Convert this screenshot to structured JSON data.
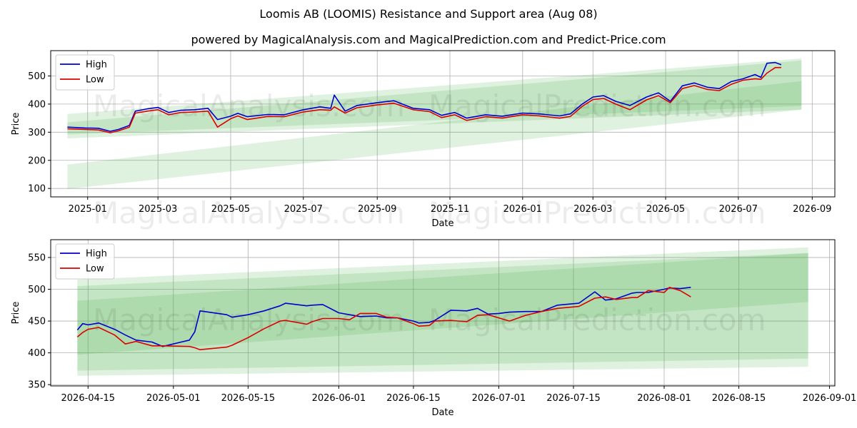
{
  "title": "Loomis AB (LOOMIS) Resistance and Support area (Aug 08)",
  "subtitle": "powered by MagicalAnalysis.com and MagicalPrediction.com and Predict-Price.com",
  "watermarks": [
    "MagicalAnalysis.com",
    "MagicalPrediction.com"
  ],
  "colors": {
    "high": "#0000cc",
    "low": "#dd0000",
    "band": "#4caf50"
  },
  "chart_data": [
    {
      "type": "line",
      "xlabel": "Date",
      "ylabel": "Price",
      "xlim": [
        "2024-12-01",
        "2026-09-20"
      ],
      "ylim": [
        70,
        590
      ],
      "x_ticks": [
        "2025-01",
        "2025-03",
        "2025-05",
        "2025-07",
        "2025-09",
        "2025-11",
        "2026-01",
        "2026-03",
        "2026-05",
        "2026-07",
        "2026-09"
      ],
      "y_ticks": [
        100,
        200,
        300,
        400,
        500
      ],
      "grid": true,
      "legend": "top-left",
      "bands": [
        {
          "x": [
            "2024-12-15",
            "2026-08-23"
          ],
          "upper": [
            365,
            562
          ],
          "lower": [
            278,
            380
          ]
        },
        {
          "x": [
            "2024-12-15",
            "2026-08-23"
          ],
          "upper": [
            335,
            555
          ],
          "lower": [
            292,
            393
          ]
        },
        {
          "x": [
            "2024-12-15",
            "2026-08-23"
          ],
          "upper": [
            185,
            482
          ],
          "lower": [
            98,
            380
          ]
        }
      ],
      "series": [
        {
          "name": "High",
          "x": [
            "2024-12-15",
            "2024-12-30",
            "2025-01-10",
            "2025-01-20",
            "2025-01-27",
            "2025-02-05",
            "2025-02-10",
            "2025-02-20",
            "2025-03-01",
            "2025-03-10",
            "2025-03-20",
            "2025-04-01",
            "2025-04-12",
            "2025-04-20",
            "2025-05-01",
            "2025-05-07",
            "2025-05-15",
            "2025-06-01",
            "2025-06-15",
            "2025-07-01",
            "2025-07-15",
            "2025-07-24",
            "2025-07-27",
            "2025-08-05",
            "2025-08-15",
            "2025-09-01",
            "2025-09-15",
            "2025-10-01",
            "2025-10-15",
            "2025-10-25",
            "2025-11-05",
            "2025-11-15",
            "2025-12-01",
            "2025-12-15",
            "2026-01-01",
            "2026-01-15",
            "2026-02-01",
            "2026-02-10",
            "2026-02-20",
            "2026-03-01",
            "2026-03-10",
            "2026-03-20",
            "2026-04-01",
            "2026-04-15",
            "2026-04-25",
            "2026-05-05",
            "2026-05-15",
            "2026-05-25",
            "2026-06-05",
            "2026-06-15",
            "2026-06-25",
            "2026-07-05",
            "2026-07-15",
            "2026-07-20",
            "2026-07-25",
            "2026-08-01",
            "2026-08-06"
          ],
          "values": [
            318,
            315,
            314,
            303,
            310,
            324,
            375,
            383,
            388,
            370,
            378,
            380,
            385,
            345,
            357,
            367,
            355,
            363,
            362,
            380,
            390,
            385,
            432,
            375,
            395,
            405,
            412,
            385,
            380,
            360,
            370,
            350,
            362,
            357,
            368,
            365,
            358,
            365,
            400,
            425,
            430,
            410,
            395,
            425,
            440,
            410,
            465,
            475,
            460,
            455,
            480,
            490,
            505,
            495,
            545,
            548,
            540
          ]
        },
        {
          "name": "Low",
          "x": [
            "2024-12-15",
            "2024-12-30",
            "2025-01-10",
            "2025-01-20",
            "2025-01-27",
            "2025-02-05",
            "2025-02-10",
            "2025-02-20",
            "2025-03-01",
            "2025-03-10",
            "2025-03-20",
            "2025-04-01",
            "2025-04-12",
            "2025-04-20",
            "2025-05-01",
            "2025-05-07",
            "2025-05-15",
            "2025-06-01",
            "2025-06-15",
            "2025-07-01",
            "2025-07-15",
            "2025-07-24",
            "2025-07-27",
            "2025-08-05",
            "2025-08-15",
            "2025-09-01",
            "2025-09-15",
            "2025-10-01",
            "2025-10-15",
            "2025-10-25",
            "2025-11-05",
            "2025-11-15",
            "2025-12-01",
            "2025-12-15",
            "2026-01-01",
            "2026-01-15",
            "2026-02-01",
            "2026-02-10",
            "2026-02-20",
            "2026-03-01",
            "2026-03-10",
            "2026-03-20",
            "2026-04-01",
            "2026-04-15",
            "2026-04-25",
            "2026-05-05",
            "2026-05-15",
            "2026-05-25",
            "2026-06-05",
            "2026-06-15",
            "2026-06-25",
            "2026-07-05",
            "2026-07-15",
            "2026-07-20",
            "2026-07-25",
            "2026-08-01",
            "2026-08-06"
          ],
          "values": [
            312,
            310,
            308,
            298,
            305,
            318,
            368,
            375,
            380,
            362,
            370,
            372,
            375,
            318,
            348,
            358,
            345,
            356,
            355,
            372,
            380,
            378,
            390,
            368,
            387,
            397,
            403,
            380,
            373,
            352,
            362,
            342,
            355,
            350,
            362,
            358,
            350,
            356,
            392,
            416,
            420,
            400,
            380,
            415,
            430,
            405,
            455,
            466,
            452,
            448,
            470,
            485,
            490,
            488,
            510,
            530,
            530
          ]
        }
      ]
    },
    {
      "type": "line",
      "xlabel": "Date",
      "ylabel": "Price",
      "xlim": [
        "2026-04-08",
        "2026-09-02"
      ],
      "ylim": [
        348,
        578
      ],
      "x_ticks": [
        "2026-04-15",
        "2026-05-01",
        "2026-05-15",
        "2026-06-01",
        "2026-06-15",
        "2026-07-01",
        "2026-07-15",
        "2026-08-01",
        "2026-08-15",
        "2026-09-01"
      ],
      "y_ticks": [
        350,
        400,
        450,
        500,
        550
      ],
      "grid": true,
      "legend": "top-left",
      "bands": [
        {
          "x": [
            "2026-04-13",
            "2026-08-28"
          ],
          "upper": [
            515,
            566
          ],
          "lower": [
            364,
            378
          ]
        },
        {
          "x": [
            "2026-04-13",
            "2026-08-28"
          ],
          "upper": [
            505,
            557
          ],
          "lower": [
            372,
            391
          ]
        },
        {
          "x": [
            "2026-04-13",
            "2026-08-28"
          ],
          "upper": [
            482,
            557
          ],
          "lower": [
            397,
            480
          ]
        }
      ],
      "series": [
        {
          "name": "High",
          "x": [
            "2026-04-13",
            "2026-04-14",
            "2026-04-15",
            "2026-04-17",
            "2026-04-20",
            "2026-04-22",
            "2026-04-24",
            "2026-04-27",
            "2026-04-29",
            "2026-05-04",
            "2026-05-05",
            "2026-05-06",
            "2026-05-11",
            "2026-05-12",
            "2026-05-15",
            "2026-05-18",
            "2026-05-21",
            "2026-05-22",
            "2026-05-26",
            "2026-05-27",
            "2026-05-29",
            "2026-06-01",
            "2026-06-03",
            "2026-06-05",
            "2026-06-08",
            "2026-06-10",
            "2026-06-12",
            "2026-06-15",
            "2026-06-16",
            "2026-06-18",
            "2026-06-19",
            "2026-06-22",
            "2026-06-25",
            "2026-06-27",
            "2026-06-29",
            "2026-07-01",
            "2026-07-03",
            "2026-07-06",
            "2026-07-09",
            "2026-07-12",
            "2026-07-16",
            "2026-07-19",
            "2026-07-21",
            "2026-07-23",
            "2026-07-26",
            "2026-07-27",
            "2026-07-29",
            "2026-08-01",
            "2026-08-02",
            "2026-08-04",
            "2026-08-06"
          ],
          "values": [
            436,
            446,
            444,
            447,
            437,
            428,
            420,
            417,
            410,
            420,
            433,
            466,
            460,
            456,
            460,
            466,
            474,
            478,
            474,
            475,
            476,
            463,
            460,
            457,
            458,
            455,
            455,
            450,
            447,
            448,
            451,
            467,
            466,
            470,
            461,
            462,
            464,
            465,
            465,
            475,
            478,
            496,
            483,
            485,
            494,
            495,
            495,
            500,
            502,
            501,
            503
          ]
        },
        {
          "name": "Low",
          "x": [
            "2026-04-13",
            "2026-04-14",
            "2026-04-15",
            "2026-04-17",
            "2026-04-20",
            "2026-04-22",
            "2026-04-24",
            "2026-04-27",
            "2026-04-29",
            "2026-05-04",
            "2026-05-05",
            "2026-05-06",
            "2026-05-11",
            "2026-05-12",
            "2026-05-15",
            "2026-05-18",
            "2026-05-21",
            "2026-05-22",
            "2026-05-26",
            "2026-05-27",
            "2026-05-29",
            "2026-06-01",
            "2026-06-03",
            "2026-06-05",
            "2026-06-08",
            "2026-06-10",
            "2026-06-12",
            "2026-06-15",
            "2026-06-16",
            "2026-06-18",
            "2026-06-19",
            "2026-06-22",
            "2026-06-25",
            "2026-06-27",
            "2026-06-29",
            "2026-07-01",
            "2026-07-03",
            "2026-07-06",
            "2026-07-09",
            "2026-07-12",
            "2026-07-16",
            "2026-07-19",
            "2026-07-21",
            "2026-07-23",
            "2026-07-26",
            "2026-07-27",
            "2026-07-29",
            "2026-08-01",
            "2026-08-02",
            "2026-08-04",
            "2026-08-06"
          ],
          "values": [
            425,
            432,
            437,
            440,
            428,
            414,
            418,
            411,
            411,
            410,
            408,
            405,
            409,
            412,
            424,
            438,
            450,
            451,
            445,
            449,
            454,
            454,
            452,
            462,
            462,
            456,
            455,
            446,
            442,
            443,
            450,
            451,
            449,
            459,
            460,
            455,
            450,
            459,
            465,
            470,
            473,
            486,
            488,
            484,
            487,
            487,
            498,
            495,
            503,
            498,
            488
          ]
        }
      ]
    }
  ]
}
